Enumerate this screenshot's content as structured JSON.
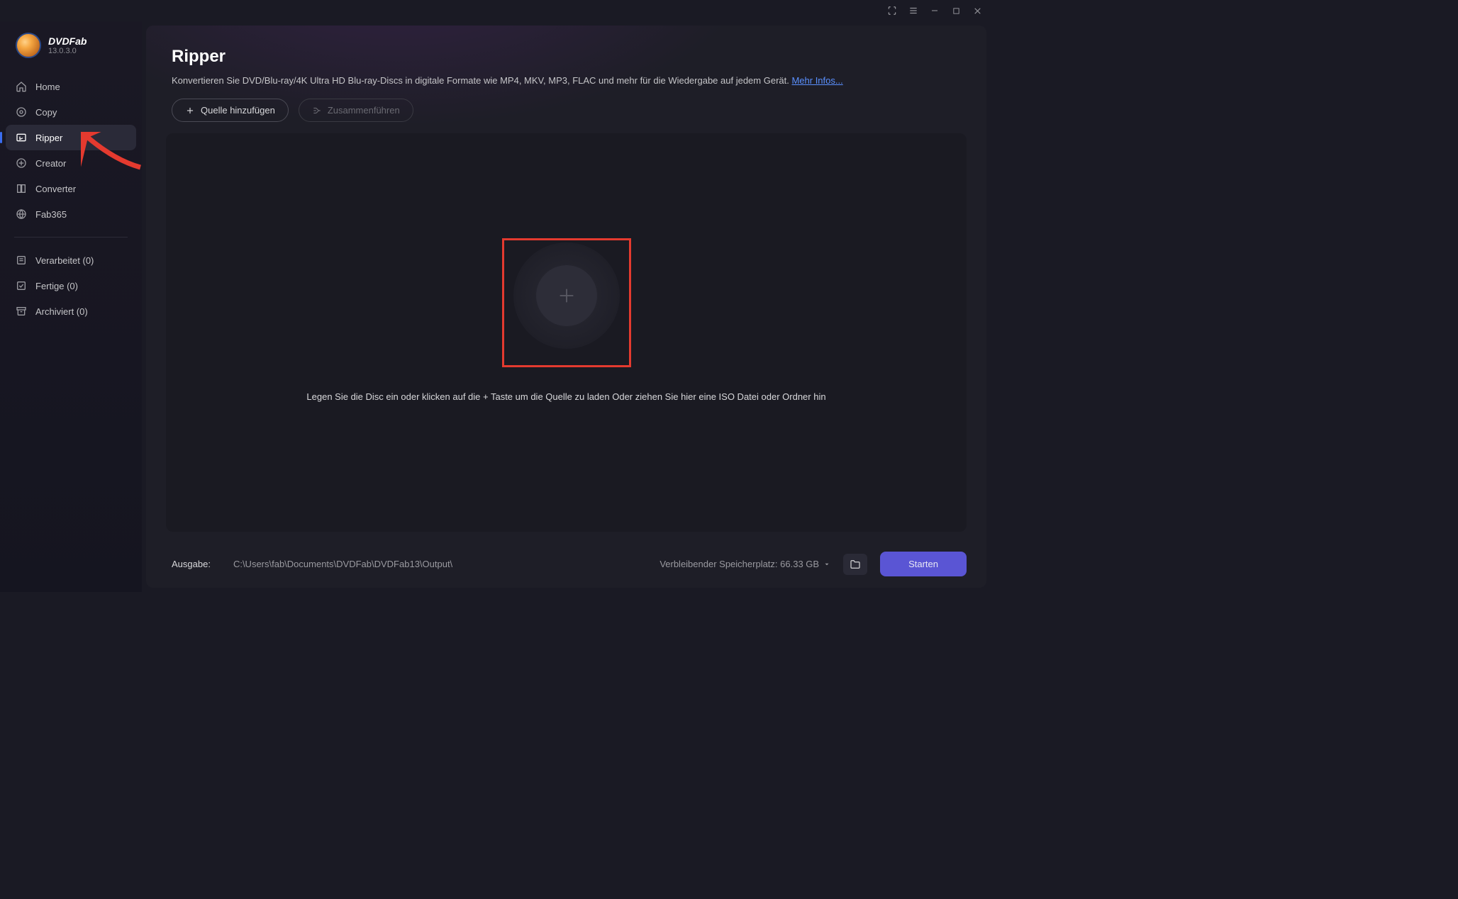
{
  "brand": {
    "name": "DVDFab",
    "version": "13.0.3.0"
  },
  "sidebar": {
    "main_items": [
      {
        "label": "Home",
        "icon": "home"
      },
      {
        "label": "Copy",
        "icon": "copy"
      },
      {
        "label": "Ripper",
        "icon": "ripper"
      },
      {
        "label": "Creator",
        "icon": "creator"
      },
      {
        "label": "Converter",
        "icon": "converter"
      },
      {
        "label": "Fab365",
        "icon": "fab365"
      }
    ],
    "queue_items": [
      {
        "label": "Verarbeitet (0)"
      },
      {
        "label": "Fertige (0)"
      },
      {
        "label": "Archiviert (0)"
      }
    ]
  },
  "page": {
    "title": "Ripper",
    "description": "Konvertieren Sie DVD/Blu-ray/4K Ultra HD Blu-ray-Discs in digitale Formate wie MP4, MKV, MP3, FLAC und mehr für die Wiedergabe auf jedem Gerät. ",
    "more_link": "Mehr Infos..."
  },
  "toolbar": {
    "add_source": "Quelle hinzufügen",
    "merge": "Zusammenführen"
  },
  "drop": {
    "text": "Legen Sie die Disc ein oder klicken auf die + Taste um die Quelle zu laden Oder ziehen Sie hier eine ISO Datei oder Ordner hin"
  },
  "footer": {
    "output_label": "Ausgabe:",
    "output_path": "C:\\Users\\fab\\Documents\\DVDFab\\DVDFab13\\Output\\",
    "remaining_space": "Verbleibender Speicherplatz: 66.33 GB",
    "start_label": "Starten"
  }
}
